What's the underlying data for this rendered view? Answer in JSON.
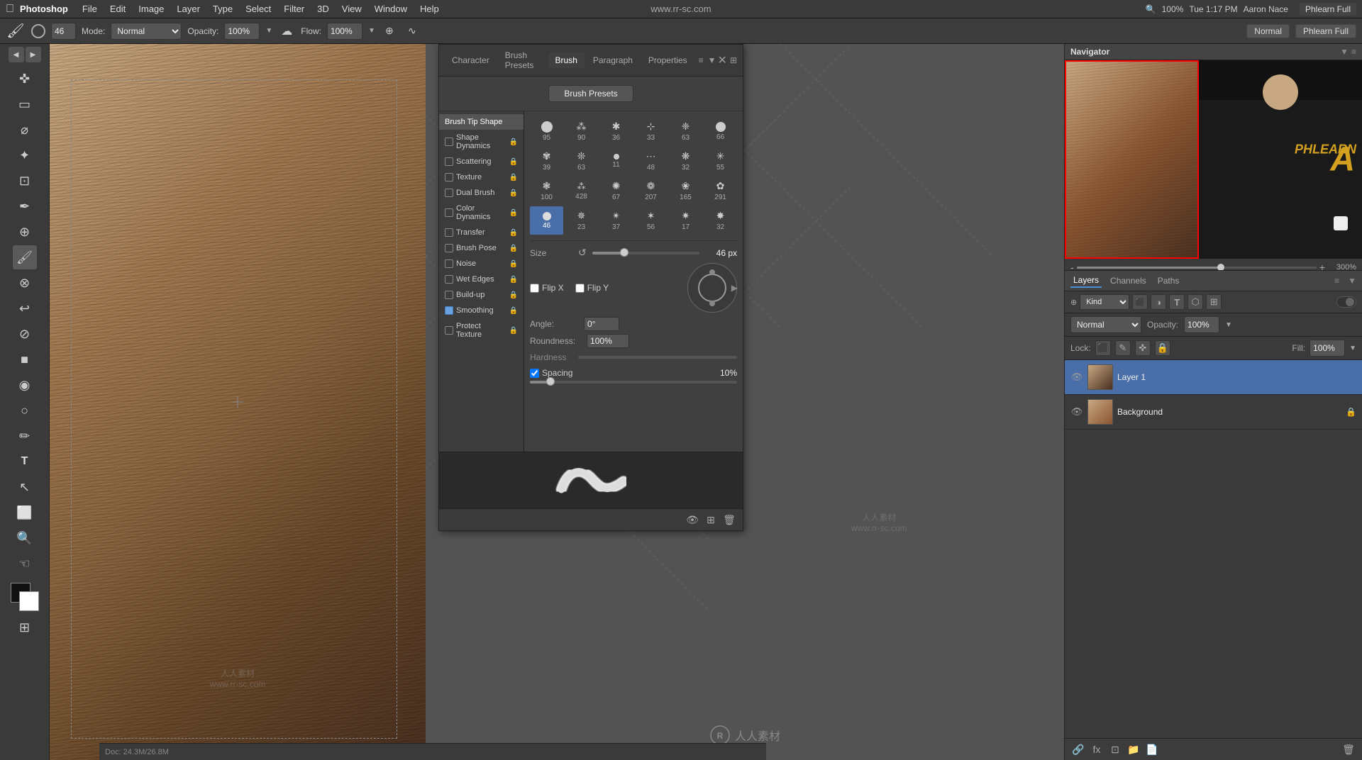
{
  "app": {
    "name": "Photoshop",
    "title": "Phlearn Full"
  },
  "menubar": {
    "apple": "⌘",
    "items": [
      "File",
      "Edit",
      "Image",
      "Layer",
      "Type",
      "Select",
      "Filter",
      "3D",
      "View",
      "Window",
      "Help"
    ],
    "right_items": [
      "100%",
      "Tue 1:17 PM",
      "Aaron Nace"
    ],
    "watermark": "www.rr-sc.com",
    "zoom_level": "100%",
    "time": "Tue 1:17 PM",
    "user": "Aaron Nace"
  },
  "optionsbar": {
    "brush_size": "46",
    "mode_label": "Mode:",
    "mode_value": "Normal",
    "opacity_label": "Opacity:",
    "opacity_value": "100%",
    "flow_label": "Flow:",
    "flow_value": "100%",
    "presets_badge": "Normal",
    "title": "Phlearn Full"
  },
  "brush_panel": {
    "tabs": [
      "Character",
      "Brush Presets",
      "Brush",
      "Paragraph",
      "Properties"
    ],
    "active_tab": "Brush",
    "presets_button": "Brush Presets",
    "nav_items": [
      {
        "label": "Brush Tip Shape",
        "checked": false,
        "active": true,
        "has_lock": false
      },
      {
        "label": "Shape Dynamics",
        "checked": false,
        "active": false,
        "has_lock": true
      },
      {
        "label": "Scattering",
        "checked": false,
        "active": false,
        "has_lock": true
      },
      {
        "label": "Texture",
        "checked": false,
        "active": false,
        "has_lock": true
      },
      {
        "label": "Dual Brush",
        "checked": false,
        "active": false,
        "has_lock": true
      },
      {
        "label": "Color Dynamics",
        "checked": false,
        "active": false,
        "has_lock": true
      },
      {
        "label": "Transfer",
        "checked": false,
        "active": false,
        "has_lock": true
      },
      {
        "label": "Brush Pose",
        "checked": false,
        "active": false,
        "has_lock": true
      },
      {
        "label": "Noise",
        "checked": false,
        "active": false,
        "has_lock": true
      },
      {
        "label": "Wet Edges",
        "checked": false,
        "active": false,
        "has_lock": true
      },
      {
        "label": "Build-up",
        "checked": false,
        "active": false,
        "has_lock": true
      },
      {
        "label": "Smoothing",
        "checked": true,
        "active": false,
        "has_lock": true
      },
      {
        "label": "Protect Texture",
        "checked": false,
        "active": false,
        "has_lock": true
      }
    ],
    "brush_grid": [
      {
        "size": 95,
        "type": "round"
      },
      {
        "size": 90,
        "type": "scatter"
      },
      {
        "size": 36,
        "type": "scatter"
      },
      {
        "size": 33,
        "type": "scatter"
      },
      {
        "size": 63,
        "type": "scatter"
      },
      {
        "size": 66,
        "type": "scatter"
      },
      {
        "size": 39,
        "type": "scatter"
      },
      {
        "size": 63,
        "type": "scatter"
      },
      {
        "size": 11,
        "type": "round"
      },
      {
        "size": 48,
        "type": "scatter"
      },
      {
        "size": 32,
        "type": "scatter"
      },
      {
        "size": 55,
        "type": "scatter"
      },
      {
        "size": 100,
        "type": "scatter"
      },
      {
        "size": 428,
        "type": "scatter"
      },
      {
        "size": 67,
        "type": "scatter"
      },
      {
        "size": 207,
        "type": "scatter"
      },
      {
        "size": 165,
        "type": "scatter"
      },
      {
        "size": 291,
        "type": "scatter"
      },
      {
        "size": 46,
        "type": "round",
        "active": true
      },
      {
        "size": 23,
        "type": "scatter"
      },
      {
        "size": 37,
        "type": "scatter"
      },
      {
        "size": 56,
        "type": "scatter"
      },
      {
        "size": 17,
        "type": "scatter"
      },
      {
        "size": 32,
        "type": "scatter"
      }
    ],
    "size": {
      "label": "Size",
      "value": "46 px",
      "percent": 30
    },
    "flip_x": "Flip X",
    "flip_y": "Flip Y",
    "angle": {
      "label": "Angle:",
      "value": "0°"
    },
    "roundness": {
      "label": "Roundness:",
      "value": "100%"
    },
    "hardness": {
      "label": "Hardness"
    },
    "spacing": {
      "label": "Spacing",
      "value": "10%",
      "checked": true,
      "percent": 10
    }
  },
  "navigator": {
    "title": "Navigator",
    "zoom": "300%"
  },
  "layers": {
    "title": "Layers",
    "tabs": [
      "Layers",
      "Channels",
      "Paths"
    ],
    "active_tab": "Layers",
    "filter_placeholder": "Kind",
    "blend_mode": "Normal",
    "opacity_label": "Opacity:",
    "opacity_value": "100%",
    "lock_label": "Lock:",
    "fill_label": "Fill:",
    "fill_value": "100%",
    "items": [
      {
        "name": "Layer 1",
        "visible": true,
        "active": true,
        "locked": false
      },
      {
        "name": "Background",
        "visible": true,
        "active": false,
        "locked": true
      }
    ]
  },
  "icons": {
    "eye": "👁",
    "lock": "🔒",
    "search": "🔍",
    "gear": "⚙",
    "close": "✕",
    "collapse": "▼",
    "expand": "►"
  }
}
